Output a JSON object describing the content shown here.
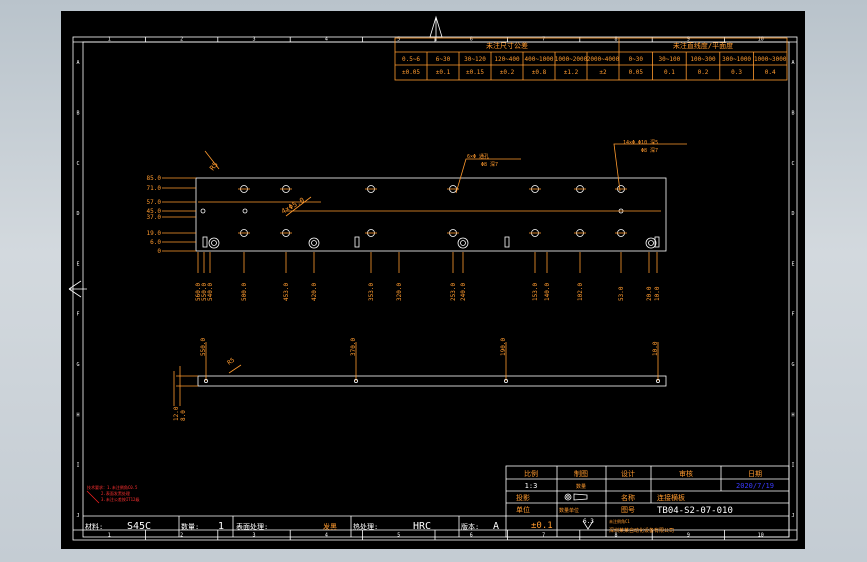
{
  "frame": {
    "columns": [
      "1",
      "2",
      "3",
      "4",
      "5",
      "6",
      "7",
      "8",
      "9",
      "10"
    ],
    "rows": [
      "A",
      "B",
      "C",
      "D",
      "E",
      "F",
      "G",
      "H",
      "I",
      "J"
    ]
  },
  "tolerance_table": {
    "linear_title": "未注尺寸公差",
    "flat_title": "未注直线度/平面度",
    "linear_ranges": [
      "0.5~6",
      "6~30",
      "30~120",
      "120~400",
      "400~1000",
      "1000~2000",
      "2000~4000"
    ],
    "linear_values": [
      "±0.05",
      "±0.1",
      "±0.15",
      "±0.2",
      "±0.8",
      "±1.2",
      "±2"
    ],
    "flat_ranges": [
      "0~30",
      "30~100",
      "100~300",
      "300~1000",
      "1000~3000"
    ],
    "flat_values": [
      "0.05",
      "0.1",
      "0.2",
      "0.3",
      "0.4"
    ]
  },
  "front_view": {
    "y_dims": [
      "85.0",
      "71.0",
      "57.0",
      "45.0",
      "37.0",
      "19.0",
      "6.0",
      "0"
    ],
    "x_dims": [
      "560.0",
      "550.0",
      "540.0",
      "500.0",
      "453.0",
      "420.0",
      "353.0",
      "320.0",
      "253.0",
      "240.0",
      "153.0",
      "140.0",
      "102.0",
      "53.0",
      "20.0",
      "10.0"
    ],
    "leaders": [
      "R5",
      "4×Φ5.0",
      "6×Φ  通孔",
      "Φ8  深7",
      "14×Φ  Φ10 深5",
      "Φ8  深7"
    ]
  },
  "top_view": {
    "dims": [
      "550.0",
      "370.0",
      "190.0",
      "10.0",
      "12.0",
      "8.0",
      "R5"
    ]
  },
  "notes": [
    "技术要求：1.未注倒角C0.5",
    "2.表面发黑处理",
    "3.未注公差按IT12级"
  ],
  "title_block": {
    "headers": [
      "比例",
      "制图",
      "设计",
      "审核",
      "日期"
    ],
    "scale": "1:3",
    "draw_label": "数量",
    "date": "2020/7/19",
    "view_label": "投影",
    "name_label": "名称",
    "part_name": "连接横板",
    "unit_label": "单位",
    "unit_value": "数量单位",
    "drawing_no_label": "图号",
    "drawing_no": "TB04-S2-07-010",
    "tolerance": "±0.1",
    "roughness": "6.3",
    "note_label": "未注倒角C1",
    "company": "深圳某某自动化设备有限公司",
    "material_label": "材料:",
    "material": "S45C",
    "qty_label": "数量:",
    "qty": "1",
    "surface_label": "表面处理:",
    "surface": "发黑",
    "heat_label": "热处理:",
    "heat": "HRC",
    "rev_label": "版本:",
    "rev": "A"
  },
  "colors": {
    "background": "#000000",
    "lines": "#ffffff",
    "dimensions": "#ff9a2e",
    "notes": "#ff2020"
  }
}
